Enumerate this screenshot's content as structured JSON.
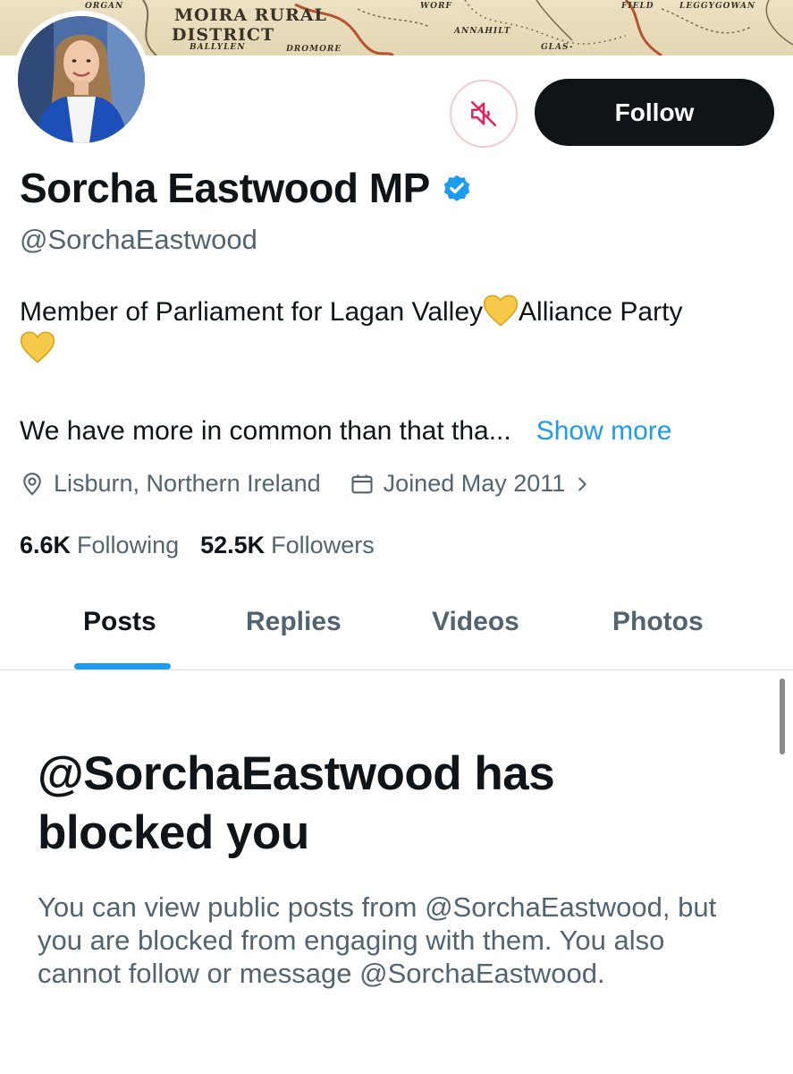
{
  "banner": {
    "labels": [
      "ORGAN",
      "MOIRA RURAL",
      "DISTRICT",
      "BALLYLEN",
      "DROMORE",
      "ANNAHILT",
      "GLAS-",
      "FIELD",
      "LEGGYGOWAN",
      "WORF"
    ]
  },
  "profile": {
    "name": "Sorcha Eastwood MP",
    "handle": "@SorchaEastwood",
    "verified_color": "#1d9bf0",
    "bio_line1_part1": "Member of Parliament for Lagan Valley",
    "bio_line1_part2": "Alliance Party",
    "bio_line2": "We have more in common than that tha...",
    "show_more": "Show more",
    "location": "Lisburn, Northern Ireland",
    "joined": "Joined May 2011",
    "following_count": "6.6K",
    "following_label": "Following",
    "followers_count": "52.5K",
    "followers_label": "Followers"
  },
  "actions": {
    "mute_icon": "speaker-muted-icon",
    "follow_label": "Follow"
  },
  "tabs": [
    {
      "label": "Posts",
      "active": true
    },
    {
      "label": "Replies",
      "active": false
    },
    {
      "label": "Videos",
      "active": false
    },
    {
      "label": "Photos",
      "active": false
    }
  ],
  "blocked": {
    "title": "@SorchaEastwood has blocked you",
    "description": "You can view public posts from @SorchaEastwood, but you are blocked from engaging with them. You also cannot follow or message @SorchaEastwood."
  },
  "colors": {
    "accent": "#1d9bf0",
    "text": "#0f1419",
    "muted": "#536471",
    "heart": "#f7c948",
    "mute_red": "#e0245e"
  }
}
